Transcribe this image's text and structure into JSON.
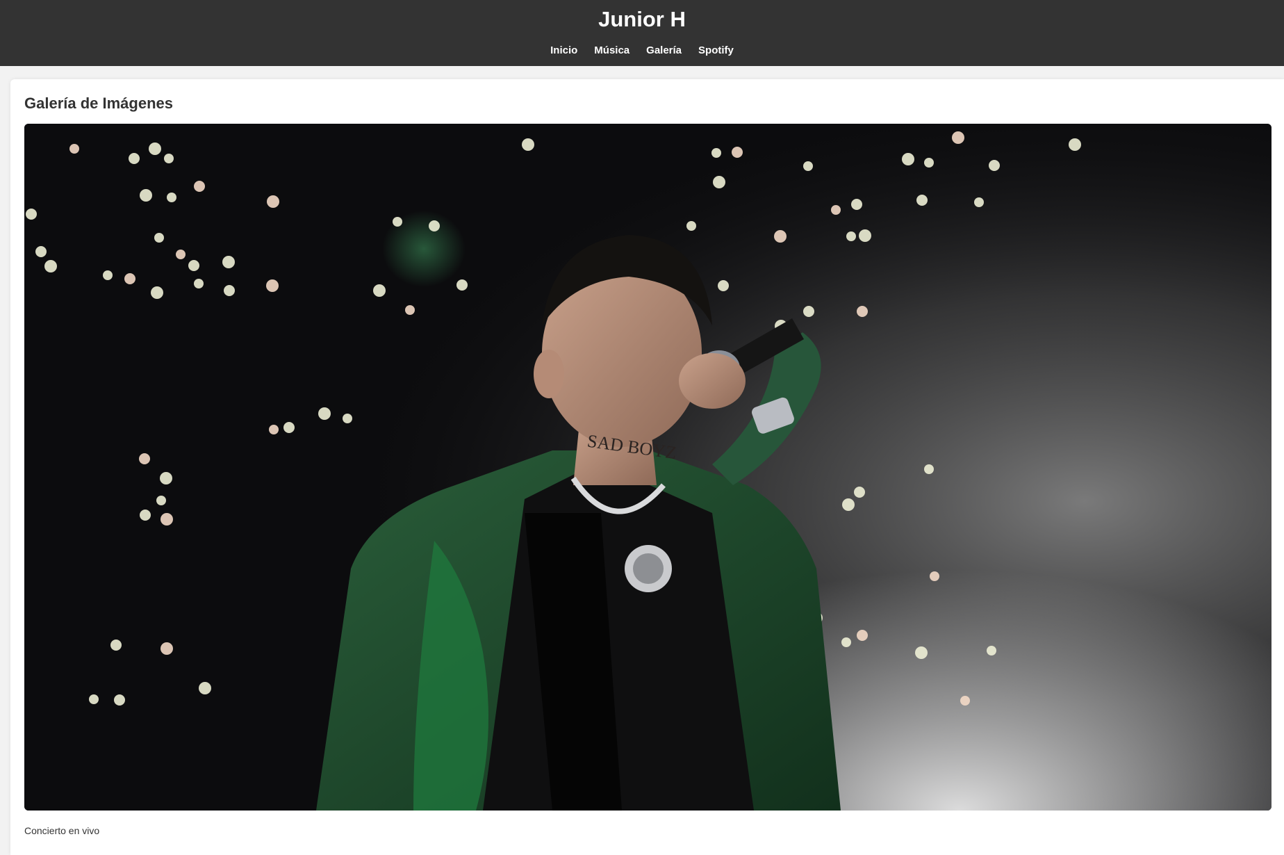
{
  "header": {
    "title": "Junior H",
    "nav": [
      {
        "label": "Inicio"
      },
      {
        "label": "Música"
      },
      {
        "label": "Galería"
      },
      {
        "label": "Spotify"
      }
    ]
  },
  "gallery": {
    "heading": "Galería de Imágenes",
    "photo": {
      "caption": "Concierto en vivo",
      "tattoo_text": "SAD BOYZ"
    }
  },
  "colors": {
    "header_bg": "#333333",
    "page_bg": "#f2f2f2",
    "card_bg": "#ffffff",
    "jacket_green": "#1f4a2c"
  }
}
